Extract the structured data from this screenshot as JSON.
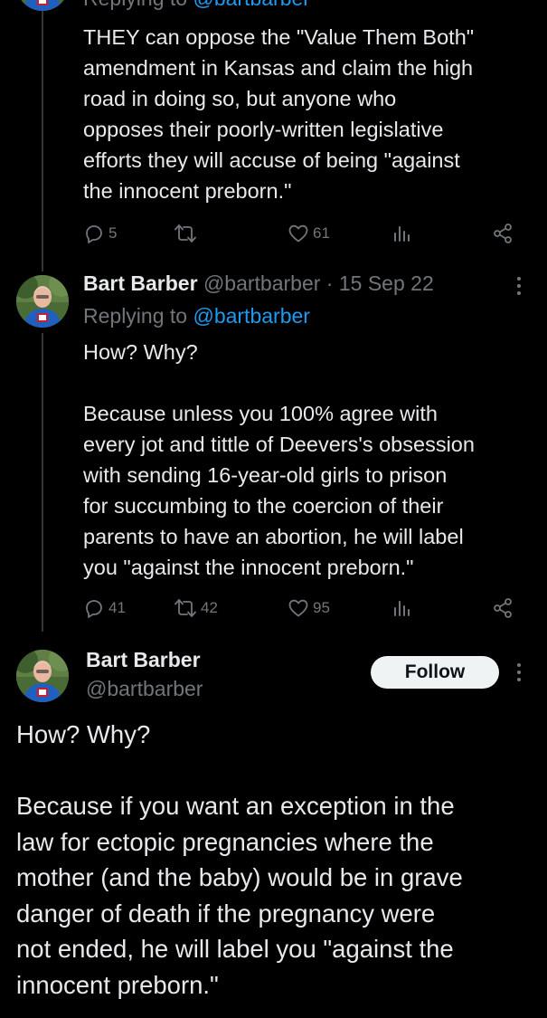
{
  "tweet1": {
    "reply_prefix": "Replying to",
    "reply_handle": "@bartbarber",
    "text": "THEY can oppose the \"Value Them Both\"\namendment in Kansas and claim the high\nroad in doing so, but anyone who\nopposes their poorly-written legislative\nefforts they will accuse of being \"against\nthe innocent preborn.\"",
    "replies": "5",
    "retweets": "",
    "likes": "61"
  },
  "tweet2": {
    "name": "Bart Barber",
    "handle": "@bartbarber",
    "separator": "·",
    "date": "15 Sep 22",
    "reply_prefix": "Replying to",
    "reply_handle": "@bartbarber",
    "text": "How? Why?\n\nBecause unless you 100% agree with\nevery jot and tittle of Deevers's obsession\nwith sending 16-year-old girls to prison\nfor succumbing to the coercion of their\nparents to have an abortion, he will label\nyou \"against the innocent preborn.\"",
    "replies": "41",
    "retweets": "42",
    "likes": "95"
  },
  "main_tweet": {
    "name": "Bart Barber",
    "handle": "@bartbarber",
    "follow_label": "Follow",
    "text": "How? Why?\n\nBecause if you want an exception in the\nlaw for ectopic pregnancies where the\nmother (and the baby) would be in grave\ndanger of death if the pregnancy were\nnot ended, he will label you \"against the\ninnocent preborn.\""
  },
  "icons": {
    "reply": "reply-icon",
    "retweet": "retweet-icon",
    "like": "heart-icon",
    "views": "views-icon",
    "share": "share-icon",
    "more": "more-icon"
  },
  "colors": {
    "background": "#000000",
    "text": "#e7e9ea",
    "muted": "#71767b",
    "link": "#1d9bf0",
    "follow_bg": "#eff3f4",
    "follow_text": "#0f1419"
  }
}
